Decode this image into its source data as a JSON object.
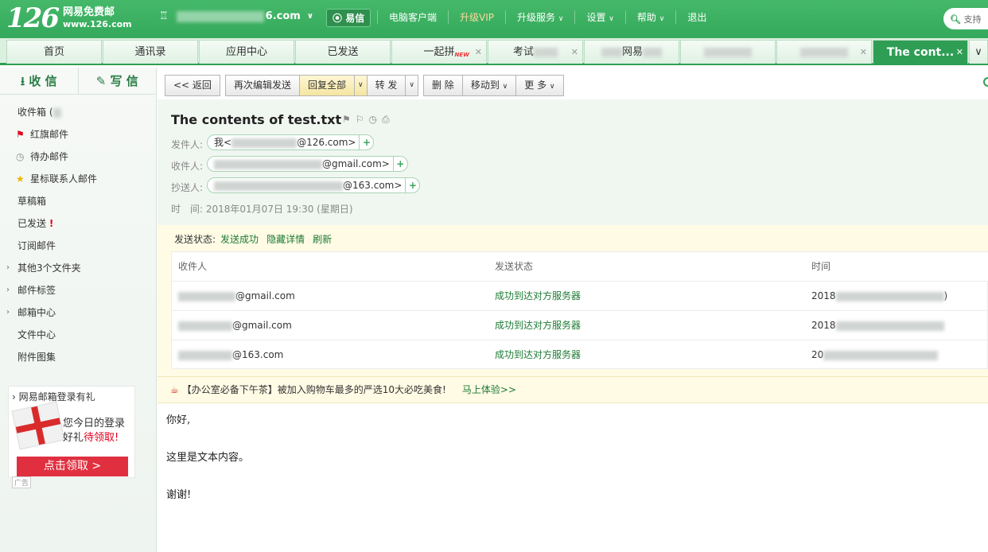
{
  "brand": {
    "logo_num": "126",
    "name": "网易免费邮",
    "domain": "www.126.com"
  },
  "topbar": {
    "user_suffix": "6.com",
    "yixin": "易信",
    "nav": [
      "电脑客户端",
      "升级VIP",
      "升级服务",
      "设置",
      "帮助",
      "退出"
    ],
    "search_placeholder": "支持"
  },
  "tabs": [
    {
      "label": "首页"
    },
    {
      "label": "通讯录"
    },
    {
      "label": "应用中心"
    },
    {
      "label": "已发送"
    },
    {
      "label": "一起拼",
      "badge": "NEW"
    },
    {
      "label": "考试"
    },
    {
      "label": "网易"
    },
    {
      "label": ""
    },
    {
      "label": ""
    },
    {
      "label": "The cont..."
    }
  ],
  "sidebar": {
    "receive": "收 信",
    "write": "写 信",
    "folders": [
      {
        "label": "收件箱 ("
      },
      {
        "label": "红旗邮件",
        "icon": "red-flag-icon"
      },
      {
        "label": "待办邮件",
        "icon": "clock-icon"
      },
      {
        "label": "星标联系人邮件",
        "icon": "star-icon"
      },
      {
        "label": "草稿箱"
      },
      {
        "label": "已发送",
        "mark": "!"
      },
      {
        "label": "订阅邮件"
      },
      {
        "label": "其他3个文件夹",
        "expand": true
      },
      {
        "label": "邮件标签",
        "expand": true
      },
      {
        "label": "邮箱中心",
        "expand": true
      },
      {
        "label": "文件中心"
      },
      {
        "label": "附件图集"
      }
    ],
    "promo": {
      "title": "网易邮箱登录有礼",
      "line1": "您今日的登录",
      "line2a": "好礼",
      "line2b": "待领取!",
      "button": "点击领取 >",
      "ad": "广告"
    }
  },
  "toolbar": {
    "back": "<< 返回",
    "reedit": "再次编辑发送",
    "reply_all": "回复全部",
    "forward": "转 发",
    "delete": "删 除",
    "move": "移动到",
    "more": "更 多"
  },
  "mail": {
    "subject": "The contents of test.txt",
    "from_label": "发件人:",
    "from_value_a": "我<",
    "from_value_b": "@126.com>",
    "to_label": "收件人:",
    "to_value": "@gmail.com>",
    "cc_label": "抄送人:",
    "cc_value": "@163.com>",
    "time_label": "时　间:",
    "time_value": "2018年01月07日 19:30 (星期日)"
  },
  "status": {
    "label": "发送状态:",
    "result": "发送成功",
    "hide": "隐藏详情",
    "refresh": "刷新",
    "columns": [
      "收件人",
      "发送状态",
      "时间"
    ],
    "rows": [
      {
        "recipient": "@gmail.com",
        "state": "成功到达对方服务器",
        "time": "2018"
      },
      {
        "recipient": "@gmail.com",
        "state": "成功到达对方服务器",
        "time": "2018"
      },
      {
        "recipient": "@163.com",
        "state": "成功到达对方服务器",
        "time": "20"
      }
    ]
  },
  "banner": {
    "text": "【办公室必备下午茶】被加入购物车最多的严选10大必吃美食!",
    "link": "马上体验>>"
  },
  "body": {
    "lines": [
      "你好,",
      "这里是文本内容。",
      "谢谢!"
    ]
  },
  "colors": {
    "brand_green": "#35a95b",
    "link_green": "#1d7a34",
    "alert_red": "#e0001b"
  }
}
